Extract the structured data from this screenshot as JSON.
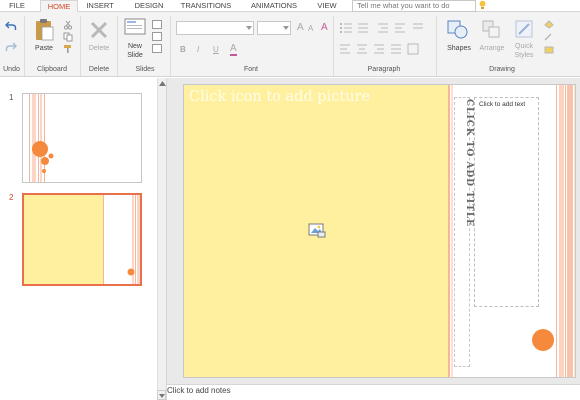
{
  "tabs": [
    "FILE",
    "HOME",
    "INSERT",
    "DESIGN",
    "TRANSITIONS",
    "ANIMATIONS",
    "VIEW"
  ],
  "active_tab": "HOME",
  "tell_me": {
    "placeholder": "Tell me what you want to do"
  },
  "ribbon": {
    "groups": {
      "undo": "Undo",
      "clipboard": "Clipboard",
      "delete": "Delete",
      "slides": "Slides",
      "font": "Font",
      "paragraph": "Paragraph",
      "drawing": "Drawing"
    },
    "buttons": {
      "paste": "Paste",
      "delete": "Delete",
      "new_slide_line1": "New",
      "new_slide_line2": "Slide",
      "shapes": "Shapes",
      "arrange": "Arrange",
      "quick_styles_line1": "Quick",
      "quick_styles_line2": "Styles"
    },
    "font_buttons": {
      "bold": "B",
      "italic": "I",
      "underline": "U",
      "font_color": "A",
      "grow": "A",
      "shrink": "A"
    }
  },
  "thumbnails": [
    {
      "number": "1",
      "selected": false
    },
    {
      "number": "2",
      "selected": true
    }
  ],
  "slide": {
    "picture_placeholder": "Click icon to add picture",
    "title_placeholder": "CLICK TO ADD TITLE",
    "text_placeholder": "Click to add text"
  },
  "notes": {
    "placeholder": "Click to add notes"
  },
  "colors": {
    "accent": "#d24726",
    "slide_yellow": "#fff0a0",
    "orange_circle": "#f58a3c",
    "stripe": "#f7b59a"
  }
}
